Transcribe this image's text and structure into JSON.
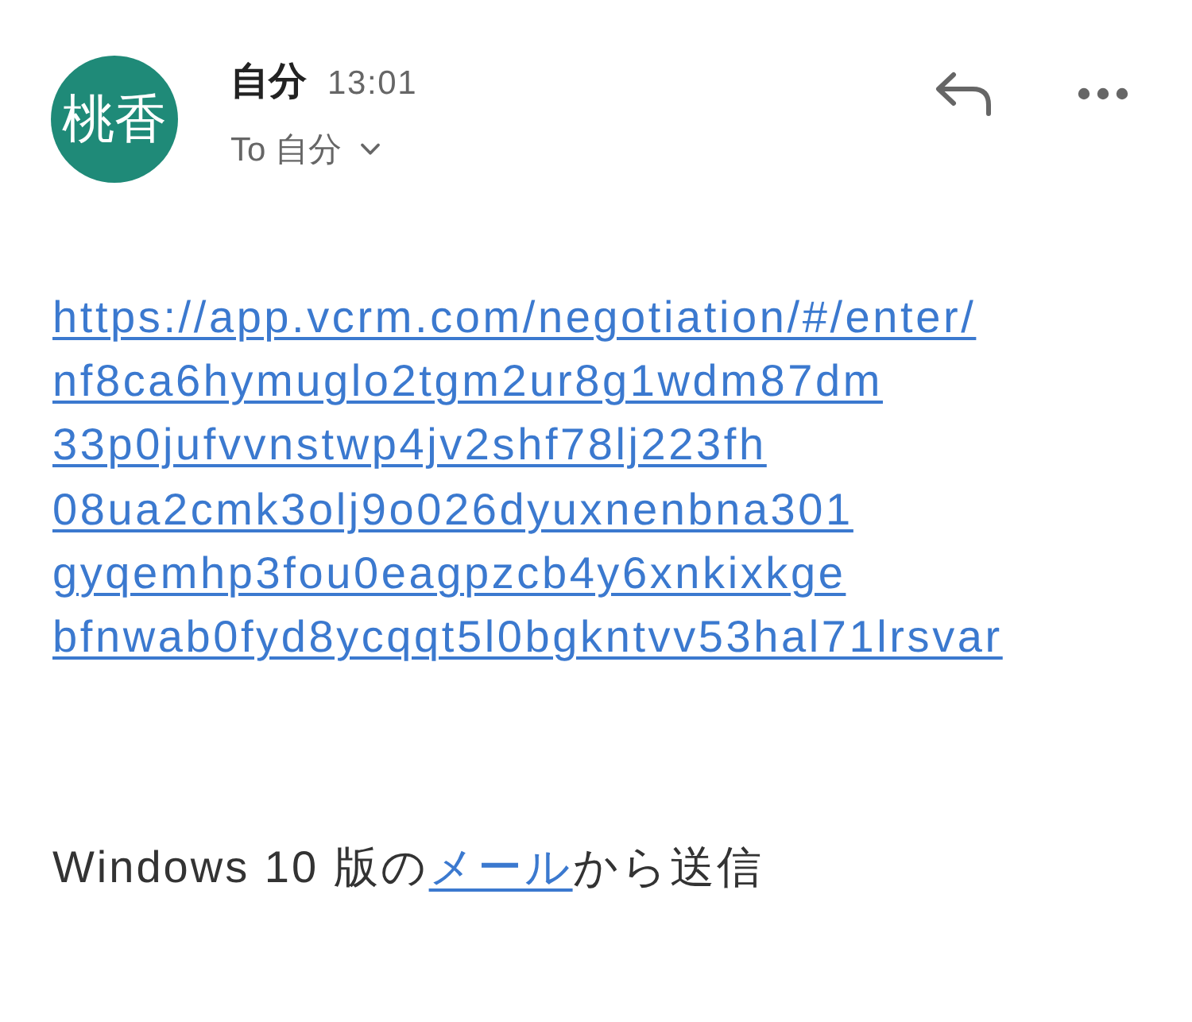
{
  "header": {
    "avatar": {
      "initials": "桃香",
      "color": "#1f8a78"
    },
    "sender": "自分",
    "time": "13:01",
    "recipients": {
      "label": "To 自分",
      "expanded": false
    },
    "actions": [
      {
        "kind": "reply"
      },
      {
        "kind": "more"
      }
    ]
  },
  "body": {
    "link_lines": [
      "https://app.vcrm.com/negotiation/#/enter/",
      "nf8ca6hymuglo2tgm2ur8g1wdm87dm",
      "33p0jufvvnstwp4jv2shf78lj223fh",
      "08ua2cmk3olj9o026dyuxnenbna301",
      "gyqemhp3fou0eagpzcb4y6xnkixkge",
      "bfnwab0fyd8ycqqt5l0bgkntvv53hal71lrsvar"
    ]
  },
  "signature": {
    "before": "Windows 10 版の",
    "link": "メール",
    "after": "から送信"
  }
}
